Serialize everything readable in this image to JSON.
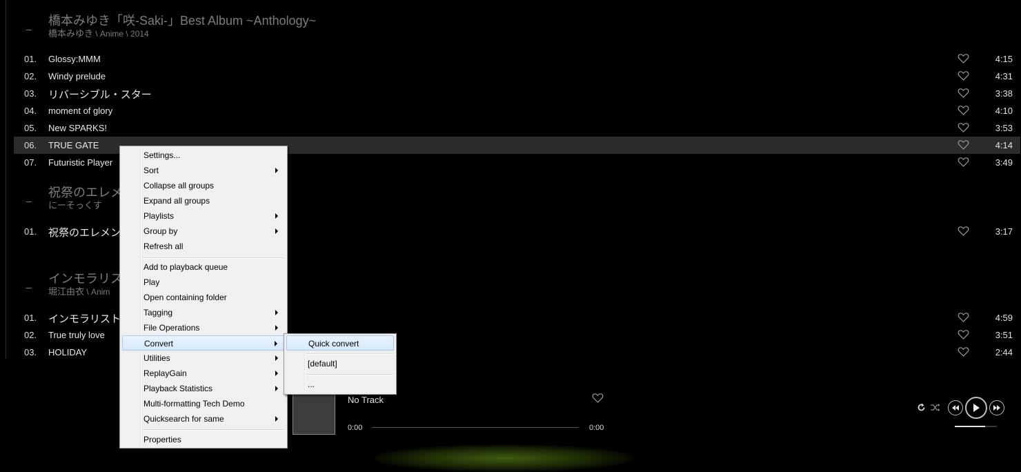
{
  "groups": [
    {
      "dash": "_",
      "title": "橋本みゆき「咲-Saki-」Best Album ~Anthology~",
      "artist": "橋本みゆき",
      "meta": " \\ Anime \\ 2014",
      "tracks": [
        {
          "num": "01.",
          "title": "Glossy:MMM",
          "dur": "4:15"
        },
        {
          "num": "02.",
          "title": "Windy prelude",
          "dur": "4:31"
        },
        {
          "num": "03.",
          "title": "リバーシブル・スター",
          "dur": "3:38"
        },
        {
          "num": "04.",
          "title": "moment of glory",
          "dur": "4:10"
        },
        {
          "num": "05.",
          "title": "New SPARKS!",
          "dur": "3:53"
        },
        {
          "num": "06.",
          "title": "TRUE GATE",
          "dur": "4:14"
        },
        {
          "num": "07.",
          "title": "Futuristic Player",
          "dur": "3:49"
        }
      ]
    },
    {
      "dash": "_",
      "title": "祝祭のエレメ",
      "artist": "にーそっくす",
      "meta": "",
      "tracks": [
        {
          "num": "01.",
          "title": "祝祭のエレメン",
          "dur": "3:17"
        }
      ]
    },
    {
      "dash": "_",
      "title": "インモラリス",
      "artist": "堀江由衣",
      "meta": " \\ Anim",
      "tracks": [
        {
          "num": "01.",
          "title": "インモラリスト",
          "dur": "4:59"
        },
        {
          "num": "02.",
          "title": "True truly love",
          "dur": "3:51"
        },
        {
          "num": "03.",
          "title": "HOLIDAY",
          "dur": "2:44"
        }
      ]
    }
  ],
  "player": {
    "now_playing": "No Track",
    "time_start": "0:00",
    "time_end": "0:00",
    "volume": 0.72
  },
  "context_menu": {
    "items": [
      {
        "label": "Settings...",
        "submenu": false
      },
      {
        "label": "Sort",
        "submenu": true
      },
      {
        "label": "Collapse all groups",
        "submenu": false
      },
      {
        "label": "Expand all groups",
        "submenu": false
      },
      {
        "label": "Playlists",
        "submenu": true
      },
      {
        "label": "Group by",
        "submenu": true
      },
      {
        "label": "Refresh all",
        "submenu": false
      },
      {
        "label": "Add to playback queue",
        "submenu": false
      },
      {
        "label": "Play",
        "submenu": false
      },
      {
        "label": "Open containing folder",
        "submenu": false
      },
      {
        "label": "Tagging",
        "submenu": true
      },
      {
        "label": "File Operations",
        "submenu": true
      },
      {
        "label": "Convert",
        "submenu": true
      },
      {
        "label": "Utilities",
        "submenu": true
      },
      {
        "label": "ReplayGain",
        "submenu": true
      },
      {
        "label": "Playback Statistics",
        "submenu": true
      },
      {
        "label": "Multi-formatting Tech Demo",
        "submenu": false
      },
      {
        "label": "Quicksearch for same",
        "submenu": true
      },
      {
        "label": "Properties",
        "submenu": false
      }
    ]
  },
  "convert_submenu": {
    "items": [
      {
        "label": "Quick convert"
      },
      {
        "label": "[default]"
      },
      {
        "label": "..."
      }
    ]
  }
}
